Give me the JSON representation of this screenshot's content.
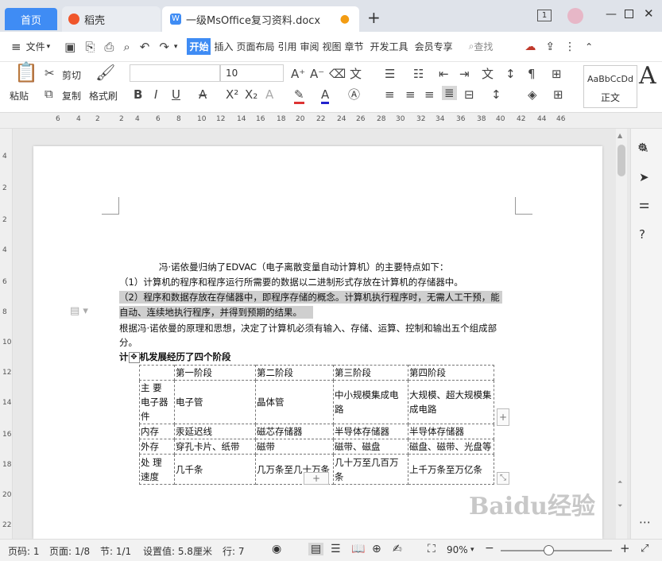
{
  "tabs": {
    "home": "首页",
    "daoke": "稻壳",
    "doc": "一级MsOffice复习资料.docx",
    "add": "+"
  },
  "window": {
    "page_count_icon": "1"
  },
  "menu": {
    "file": "文件",
    "items": [
      "开始",
      "插入",
      "页面布局",
      "引用",
      "审阅",
      "视图",
      "章节",
      "开发工具",
      "会员专享"
    ],
    "search": "查找"
  },
  "ribbon": {
    "paste": "粘贴",
    "cut": "剪切",
    "copy": "复制",
    "format_painter": "格式刷",
    "font_name": "",
    "font_size": "10",
    "style_preview": "AaBbCcDd",
    "style_name": "正文",
    "style_big": "A"
  },
  "ruler": {
    "ticks": [
      "6",
      "4",
      "2",
      "2",
      "4",
      "6",
      "8",
      "10",
      "12",
      "14",
      "16",
      "18",
      "20",
      "22",
      "24",
      "26",
      "28",
      "30",
      "32",
      "34",
      "36",
      "38",
      "40",
      "42",
      "44",
      "46"
    ],
    "vticks": [
      "4",
      "2",
      "2",
      "4",
      "6",
      "8",
      "10",
      "12",
      "14",
      "16",
      "18",
      "20",
      "22"
    ]
  },
  "doc": {
    "p1": "冯·诺依曼归纳了EDVAC（电子离散变量自动计算机）的主要特点如下：",
    "p2": "（1）计算机的程序和程序运行所需要的数据以二进制形式存放在计算机的存储器中。",
    "p3a": "（2）程序和数据存放在存储器中，即程序存储的概念。计算机执行程序时，无需人工干预，能",
    "p3b": "自动、连续地执行程序，并得到预期的结果。",
    "p4a": "根据冯·诺依曼的原理和思想，决定了计算机必须有输入、存储、运算、控制和输出五个组成部",
    "p4b": "分。",
    "heading": "计算机发展经历了四个阶段",
    "heading_visible": "机发展经历了四个阶段",
    "heading_first": "计",
    "table": [
      [
        "",
        "第一阶段",
        "第二阶段",
        "第三阶段",
        "第四阶段"
      ],
      [
        "主 要 电子器件",
        "电子管",
        "晶体管",
        "中小规模集成电路",
        "大规模、超大规模集成电路"
      ],
      [
        "内存",
        "汞延迟线",
        "磁芯存储器",
        "半导体存储器",
        "半导体存储器"
      ],
      [
        "外存",
        "穿孔卡片、纸带",
        "磁带",
        "磁带、磁盘",
        "磁盘、磁带、光盘等"
      ],
      [
        "处 理 速度",
        "几千条",
        "几万条至几十万条",
        "几十万至几百万条",
        "上千万条至万亿条"
      ]
    ]
  },
  "status": {
    "page": "页码: 1",
    "pages": "页面: 1/8",
    "section": "节: 1/1",
    "setting": "设置值: 5.8厘米",
    "row": "行: 7",
    "zoom": "90%"
  },
  "watermark": "Baidu经验"
}
